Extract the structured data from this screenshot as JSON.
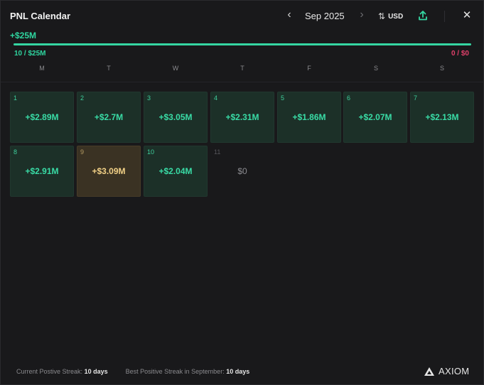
{
  "header": {
    "title": "PNL Calendar",
    "month": "Sep 2025",
    "prev_icon": "chevron-left-icon",
    "next_icon": "chevron-right-icon",
    "currency": "USD",
    "sort_icon": "sort-arrows-icon",
    "share_icon": "upload-share-icon",
    "close_icon": "close-icon",
    "prev_glyph": "‹",
    "next_glyph": "›",
    "sort_glyph": "⇅",
    "close_glyph": "✕"
  },
  "summary": {
    "total": "+$25M",
    "progress_left": "10 / $25M",
    "progress_right": "0 / $0",
    "progress_fraction": 1.0,
    "accent_color": "#35d6a2",
    "negative_color": "#e0406a"
  },
  "weekdays": [
    "M",
    "T",
    "W",
    "T",
    "F",
    "S",
    "S"
  ],
  "days": [
    {
      "day": "1",
      "value": "+$2.89M",
      "state": "pos"
    },
    {
      "day": "2",
      "value": "+$2.7M",
      "state": "pos"
    },
    {
      "day": "3",
      "value": "+$3.05M",
      "state": "pos"
    },
    {
      "day": "4",
      "value": "+$2.31M",
      "state": "pos"
    },
    {
      "day": "5",
      "value": "+$1.86M",
      "state": "pos"
    },
    {
      "day": "6",
      "value": "+$2.07M",
      "state": "pos"
    },
    {
      "day": "7",
      "value": "+$2.13M",
      "state": "pos"
    },
    {
      "day": "8",
      "value": "+$2.91M",
      "state": "pos"
    },
    {
      "day": "9",
      "value": "+$3.09M",
      "state": "best"
    },
    {
      "day": "10",
      "value": "+$2.04M",
      "state": "pos"
    },
    {
      "day": "11",
      "value": "$0",
      "state": "zero"
    }
  ],
  "footer": {
    "current_label": "Current Postive Streak:",
    "current_value": "10 days",
    "best_label": "Best Positive Streak in September:",
    "best_value": "10 days",
    "brand": "AXIOM",
    "brand_icon": "axiom-logo-icon"
  }
}
